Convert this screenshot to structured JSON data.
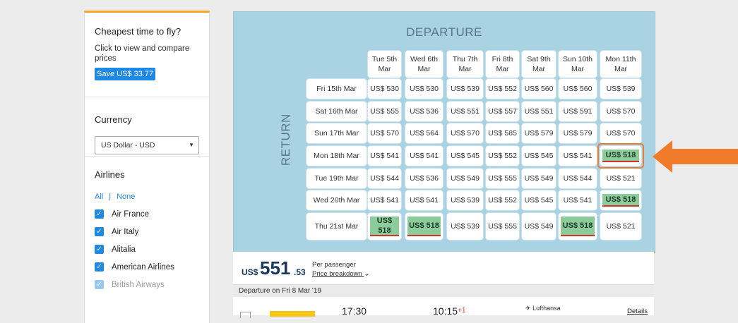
{
  "sidebar": {
    "cheapest": {
      "title": "Cheapest time to fly?",
      "text": "Click to view and compare prices",
      "save_button": "Save US$ 33.77"
    },
    "currency": {
      "title": "Currency",
      "selected": "US Dollar - USD"
    },
    "airlines": {
      "title": "Airlines",
      "all": "All",
      "separator": "|",
      "none": "None",
      "items": [
        "Air France",
        "Air Italy",
        "Alitalia",
        "American Airlines",
        "British Airways"
      ]
    }
  },
  "matrix": {
    "departure_title": "DEPARTURE",
    "return_title": "RETURN",
    "columns": [
      "Tue 5th Mar",
      "Wed 6th Mar",
      "Thu 7th Mar",
      "Fri 8th Mar",
      "Sat 9th Mar",
      "Sun 10th Mar",
      "Mon 11th Mar"
    ],
    "rows": [
      {
        "label": "Fri 15th Mar",
        "prices": [
          "US$ 530",
          "US$ 530",
          "US$ 539",
          "US$ 552",
          "US$ 560",
          "US$ 560",
          "US$ 539"
        ],
        "cheapest": []
      },
      {
        "label": "Sat 16th Mar",
        "prices": [
          "US$ 555",
          "US$ 536",
          "US$ 551",
          "US$ 557",
          "US$ 551",
          "US$ 591",
          "US$ 570"
        ],
        "cheapest": []
      },
      {
        "label": "Sun 17th Mar",
        "prices": [
          "US$ 570",
          "US$ 564",
          "US$ 570",
          "US$ 585",
          "US$ 579",
          "US$ 579",
          "US$ 570"
        ],
        "cheapest": []
      },
      {
        "label": "Mon 18th Mar",
        "prices": [
          "US$ 541",
          "US$ 541",
          "US$ 545",
          "US$ 552",
          "US$ 545",
          "US$ 541",
          "US$ 518"
        ],
        "cheapest": [
          6
        ]
      },
      {
        "label": "Tue 19th Mar",
        "prices": [
          "US$ 544",
          "US$ 536",
          "US$ 549",
          "US$ 555",
          "US$ 549",
          "US$ 544",
          "US$ 521"
        ],
        "cheapest": []
      },
      {
        "label": "Wed 20th Mar",
        "prices": [
          "US$ 541",
          "US$ 541",
          "US$ 539",
          "US$ 552",
          "US$ 545",
          "US$ 541",
          "US$ 518"
        ],
        "cheapest": [
          6
        ]
      },
      {
        "label": "Thu 21st Mar",
        "prices": [
          "US$ 518",
          "US$ 518",
          "US$ 539",
          "US$ 555",
          "US$ 549",
          "US$ 518",
          "US$ 521"
        ],
        "cheapest": [
          0,
          1,
          5
        ]
      }
    ],
    "cheapest_color": "#8ccc9b",
    "highlight_color": "#e87d35"
  },
  "price_summary": {
    "currency": "US$",
    "whole": "551",
    "decimals": ".53",
    "per_passenger": "Per passenger",
    "breakdown": "Price breakdown"
  },
  "departure_bar": {
    "text": "Departure on Fri 8 Mar '19"
  },
  "flight": {
    "dep_time": "17:30",
    "arr_time": "10:15",
    "day_offset": "+1",
    "airline": "Lufthansa",
    "details": "Details"
  }
}
